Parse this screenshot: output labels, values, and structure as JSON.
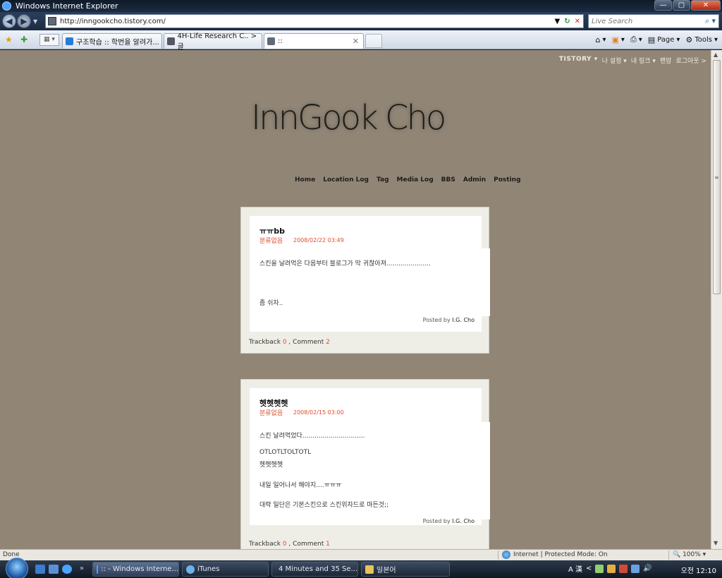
{
  "window": {
    "title": "Windows Internet Explorer",
    "minimize_label": "—",
    "maximize_label": "▢",
    "close_label": "✕"
  },
  "addressbar": {
    "url": "http://inngookcho.tistory.com/",
    "search_placeholder": "Live Search"
  },
  "tabs": [
    {
      "label": "구조학습 :: 학번을 알려가..."
    },
    {
      "label": "4H-Life Research C.. > 글"
    },
    {
      "label": "::"
    }
  ],
  "commands": {
    "page_label": "Page",
    "tools_label": "Tools"
  },
  "blog": {
    "tistory_nav": [
      "TISTORY ▾",
      "나 설정 ▾",
      "내 링크 ▾",
      "팬암",
      "로그아웃 >"
    ],
    "title": "InnGook Cho",
    "menu": [
      "Home",
      "Location Log",
      "Tag",
      "Media Log",
      "BBS",
      "Admin",
      "Posting"
    ]
  },
  "posts": [
    {
      "title": "ㅠㅠbb",
      "category": "분류없음",
      "date": "2008/02/22 03:49",
      "lines": [
        "스킨을 날려먹은 다음부터 블로그가 막 귀찮아져......................",
        "",
        "",
        "",
        "좀 쉬자.."
      ],
      "posted_by_label": "Posted by",
      "author": "I.G. Cho",
      "trackback_label": "Trackback",
      "trackback_count": "0",
      "comment_label": "Comment",
      "comment_count": "2"
    },
    {
      "title": "헷헷헷헷",
      "category": "분류없음",
      "date": "2008/02/15 03:00",
      "lines": [
        "스킨 날려먹었다...............................",
        "",
        "OTLOTLTOLTOTL",
        "헷헷헷헷",
        "",
        "내일 일어나서 해야지....ㅠㅠㅠ",
        "",
        "대략 일단은 기본스킨으로 스킨위자드로 마든것;;"
      ],
      "posted_by_label": "Posted by",
      "author": "I.G. Cho",
      "trackback_label": "Trackback",
      "trackback_count": "0",
      "comment_label": "Comment",
      "comment_count": "1"
    }
  ],
  "statusbar": {
    "status": "Done",
    "zone": "Internet | Protected Mode: On",
    "zoom": "100%"
  },
  "taskbar": {
    "tasks": [
      {
        "label": ":: - Windows Interne..."
      },
      {
        "label": "iTunes"
      },
      {
        "label": "4 Minutes and 35 Se..."
      },
      {
        "label": "일본어"
      }
    ],
    "ime": "A 漢",
    "clock": "오전 12:10"
  }
}
